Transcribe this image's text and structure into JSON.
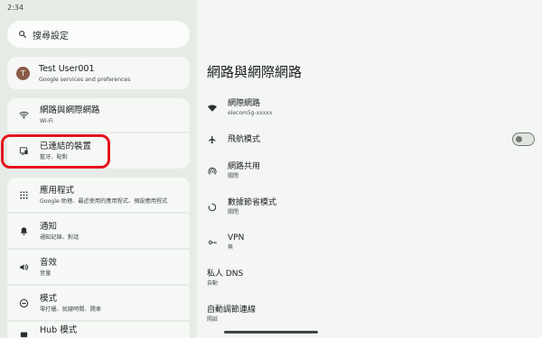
{
  "status_bar": {
    "time": "2:34",
    "icons": [
      "wifi-icon",
      "battery-icon"
    ]
  },
  "search": {
    "placeholder": "搜尋設定",
    "icon": "search-icon"
  },
  "account": {
    "avatar_letter": "T",
    "name": "Test User001",
    "subtitle": "Google services and preferences"
  },
  "sidebar": {
    "items": [
      {
        "label": "網路與網際網路",
        "subtitle": "Wi-Fi",
        "icon": "wifi-icon"
      },
      {
        "label": "已連結的裝置",
        "subtitle": "藍牙、配對",
        "icon": "connected-devices-icon"
      },
      {
        "label": "應用程式",
        "subtitle": "Google 助理、最近使用的應用程式、預設應用程式",
        "icon": "apps-grid-icon"
      },
      {
        "label": "通知",
        "subtitle": "通知記錄、對話",
        "icon": "bell-icon"
      },
      {
        "label": "音效",
        "subtitle": "音量",
        "icon": "volume-icon"
      },
      {
        "label": "模式",
        "subtitle": "零打擾、就寢時間、開車",
        "icon": "modes-icon"
      },
      {
        "label": "Hub 模式",
        "subtitle": "",
        "icon": "hub-icon"
      }
    ]
  },
  "detail": {
    "title": "網路與網際網路",
    "items": [
      {
        "label": "網際網路",
        "subtitle": "elecom5g-xxxxx",
        "icon": "wifi-icon"
      },
      {
        "label": "飛航模式",
        "subtitle": "",
        "icon": "airplane-icon",
        "toggle": false
      },
      {
        "label": "網路共用",
        "subtitle": "關閉",
        "icon": "hotspot-icon"
      },
      {
        "label": "數據節省模式",
        "subtitle": "關閉",
        "icon": "data-saver-icon"
      },
      {
        "label": "VPN",
        "subtitle": "無",
        "icon": "vpn-key-icon"
      },
      {
        "label": "私人 DNS",
        "subtitle": "自動",
        "icon": ""
      },
      {
        "label": "自動調節連線",
        "subtitle": "開啟",
        "icon": ""
      }
    ]
  },
  "colors": {
    "highlight": "#e5141d",
    "sidebar_bg": "#e6ebe6",
    "detail_bg": "#f3f6f3",
    "card_bg": "#f5f8f5",
    "avatar": "#8a5a48"
  }
}
